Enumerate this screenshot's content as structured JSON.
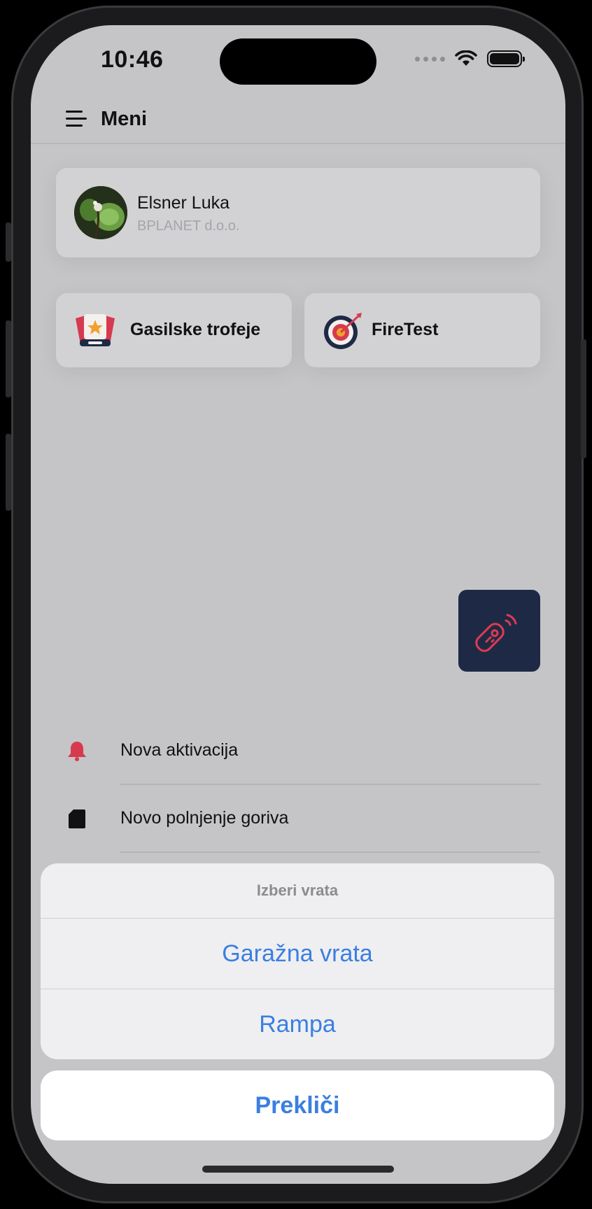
{
  "status": {
    "time": "10:46"
  },
  "header": {
    "title": "Meni"
  },
  "profile": {
    "name": "Elsner Luka",
    "company": "BPLANET d.o.o."
  },
  "tiles": [
    {
      "label": "Gasilske trofeje",
      "icon": "trophy-icon"
    },
    {
      "label": "FireTest",
      "icon": "target-icon"
    }
  ],
  "remote": {
    "icon": "remote-control-icon",
    "accent": "#e03a52",
    "background": "#1e2a45"
  },
  "list": [
    {
      "label": "Nova aktivacija",
      "icon": "bell-icon"
    },
    {
      "label": "Novo polnjenje goriva",
      "icon": "document-icon"
    }
  ],
  "action_sheet": {
    "title": "Izberi vrata",
    "options": [
      "Garažna vrata",
      "Rampa"
    ],
    "cancel": "Prekliči"
  },
  "colors": {
    "action_blue": "#3b7fe0",
    "alert_red": "#d63a4f"
  }
}
